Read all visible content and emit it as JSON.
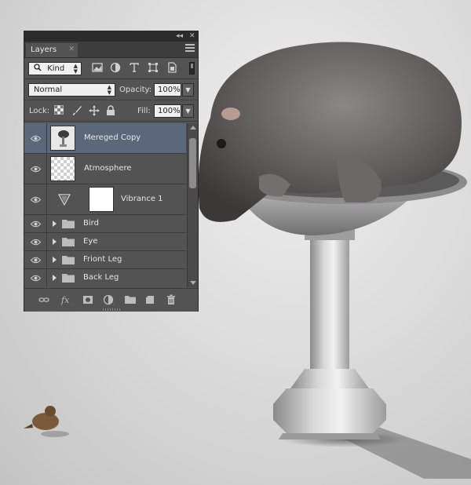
{
  "panel": {
    "tab_label": "Layers",
    "filter_kind": "Kind",
    "blend_mode": "Normal",
    "opacity_label": "Opacity:",
    "opacity_value": "100%",
    "lock_label": "Lock:",
    "fill_label": "Fill:",
    "fill_value": "100%"
  },
  "layers": [
    {
      "name": "Mereged Copy",
      "selected": true
    },
    {
      "name": "Atmosphere"
    },
    {
      "name": "Vibrance 1"
    },
    {
      "name": "Bird"
    },
    {
      "name": "Eye"
    },
    {
      "name": "Friont Leg"
    },
    {
      "name": "Back Leg"
    }
  ],
  "icons": {
    "filter_icons": [
      "image-filter-icon",
      "adjustment-filter-icon",
      "type-filter-icon",
      "shape-filter-icon",
      "smart-object-filter-icon"
    ],
    "lock_icons": [
      "lock-transparent-icon",
      "lock-image-icon",
      "lock-position-icon",
      "lock-all-icon"
    ],
    "footer_icons": [
      "link-layers-icon",
      "fx-icon",
      "add-mask-icon",
      "new-adjustment-icon",
      "new-group-icon",
      "new-layer-icon",
      "delete-layer-icon"
    ]
  },
  "colors": {
    "panel_bg": "#535353",
    "selected_row": "#5b687b",
    "canvas_bg": "#dcdcdc"
  }
}
